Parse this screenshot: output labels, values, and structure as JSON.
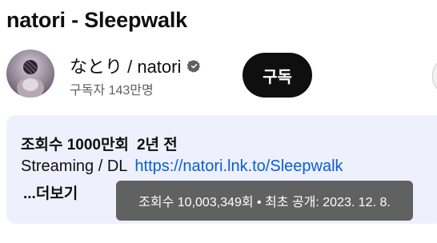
{
  "video": {
    "title": "natori - Sleepwalk"
  },
  "channel": {
    "name": "なとり / natori",
    "subscribers": "구독자 143만명",
    "avatar_icon": "channel-avatar",
    "verified_icon": "verified-check-icon"
  },
  "subscribe": {
    "label": "구독"
  },
  "description": {
    "views": "조회수 1000만회",
    "age": "2년 전",
    "prefix": "Streaming / DL",
    "link": "https://natori.lnk.to/Sleepwalk",
    "more_label": "...더보기"
  },
  "tooltip": {
    "text": "조회수 10,003,349회 • 최초 공개: 2023. 12. 8."
  },
  "colors": {
    "link": "#065fd4",
    "description_bg": "#eef0fd",
    "subscribe_bg": "#0f0f0f",
    "tooltip_bg": "#616161"
  }
}
